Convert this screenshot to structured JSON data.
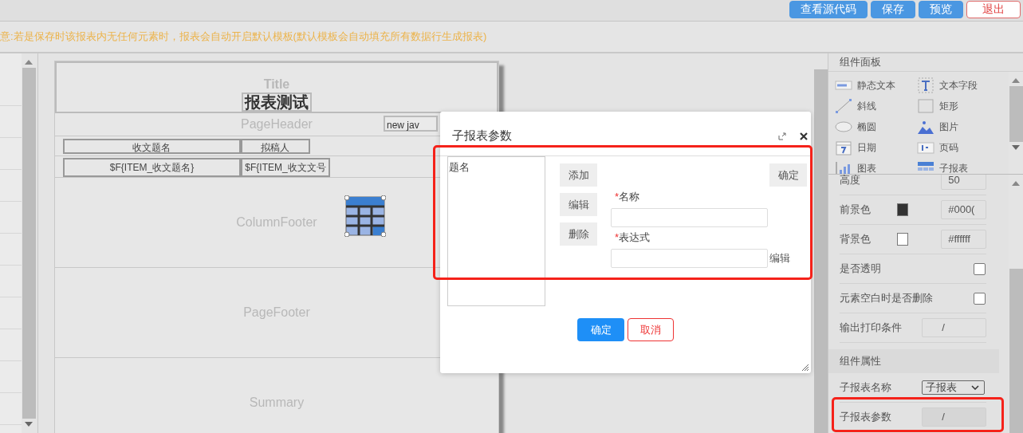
{
  "toolbar": {
    "buttons": [
      {
        "label": "查看源代码",
        "kind": "primary"
      },
      {
        "label": "保存",
        "kind": "primary"
      },
      {
        "label": "预览",
        "kind": "primary"
      },
      {
        "label": "退出",
        "kind": "danger"
      }
    ]
  },
  "notice": "意:若是保存时该报表内无任何元素时，报表会自动开启默认模板(默认模板会自动填充所有数据行生成报表)",
  "report": {
    "bands": [
      {
        "name": "Title",
        "kind": "heading",
        "heading": "报表测试"
      },
      {
        "name": "PageHeader",
        "kind": "field",
        "field": "new jav"
      },
      {
        "kind": "cells",
        "cells": [
          "收文题名",
          "拟稿人"
        ]
      },
      {
        "kind": "cells",
        "cells": [
          "$F{ITEM_收文题名}",
          "$F{ITEM_收文文号"
        ]
      },
      {
        "name": "ColumnFooter",
        "kind": "subreport",
        "selected": true
      },
      {
        "name": "PageFooter",
        "kind": "plain"
      },
      {
        "name": "Summary",
        "kind": "plain"
      }
    ]
  },
  "palette": {
    "title": "组件面板",
    "items": [
      {
        "label": "静态文本",
        "kind": "static-text"
      },
      {
        "label": "文本字段",
        "kind": "text-field"
      },
      {
        "label": "斜线",
        "kind": "line"
      },
      {
        "label": "矩形",
        "kind": "rect"
      },
      {
        "label": "椭圆",
        "kind": "ellipse"
      },
      {
        "label": "图片",
        "kind": "image"
      },
      {
        "label": "日期",
        "kind": "date"
      },
      {
        "label": "页码",
        "kind": "page"
      },
      {
        "label": "图表",
        "kind": "chart"
      },
      {
        "label": "子报表",
        "kind": "subreport"
      }
    ]
  },
  "properties": [
    {
      "label": "高度",
      "kind": "input",
      "value": "50"
    },
    {
      "label": "前景色",
      "kind": "color",
      "color": "#333333",
      "value": "#000("
    },
    {
      "label": "背景色",
      "kind": "color",
      "color": "#ffffff",
      "value": "#ffffff"
    },
    {
      "label": "是否透明",
      "kind": "checkbox",
      "checked": false
    },
    {
      "label": "元素空白时是否删除",
      "kind": "checkbox",
      "checked": false
    },
    {
      "label": "输出打印条件",
      "kind": "input",
      "value": "/"
    },
    {
      "label": "组件属性",
      "kind": "section"
    },
    {
      "label": "子报表名称",
      "kind": "select",
      "value": "子报表"
    },
    {
      "label": "子报表参数",
      "kind": "input",
      "value": "/",
      "disabled": true
    }
  ],
  "dialog": {
    "title": "子报表参数",
    "params": [
      {
        "label": "题名",
        "selected": false
      }
    ],
    "side_buttons": [
      "添加",
      "编辑",
      "删除"
    ],
    "apply_button": "确定",
    "fields": [
      {
        "mark": "*",
        "label": "名称"
      },
      {
        "mark": "*",
        "label": "表达式",
        "action": "编辑"
      }
    ],
    "ok": "确定",
    "cancel": "取消"
  }
}
